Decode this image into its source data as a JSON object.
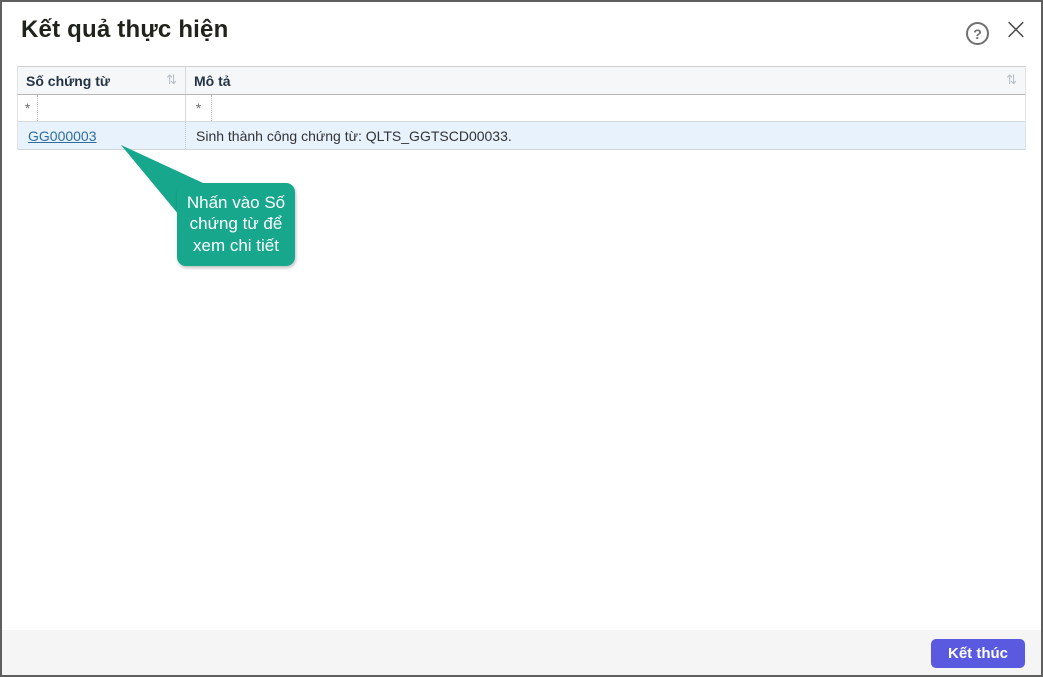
{
  "dialog": {
    "title": "Kết quả thực hiện",
    "help_icon": "?",
    "close_icon": "×"
  },
  "table": {
    "columns": [
      {
        "label": "Số chứng từ",
        "sort_icon": "⇅"
      },
      {
        "label": "Mô tả",
        "sort_icon": "⇅"
      }
    ],
    "filter_operator": "*",
    "filter_placeholder": "",
    "rows": [
      {
        "doc_number": "GG000003",
        "description": "Sinh thành công chứng từ: QLTS_GGTSCD00033."
      }
    ]
  },
  "callout": {
    "text": "Nhấn vào Số chứng từ để xem chi tiết"
  },
  "footer": {
    "finish_label": "Kết thúc"
  },
  "colors": {
    "callout_green": "#17a78c",
    "finish_button_purple": "#5a5ae0",
    "row_highlight_blue": "#e7f2fc",
    "link_blue": "#2e6da4"
  }
}
